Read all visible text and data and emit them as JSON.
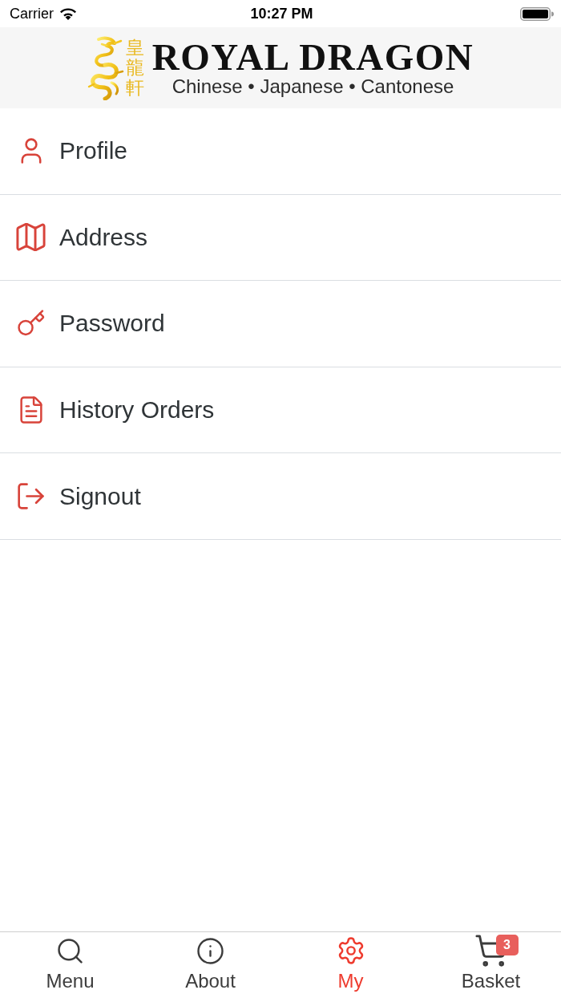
{
  "status_bar": {
    "carrier": "Carrier",
    "time": "10:27 PM"
  },
  "header": {
    "logo_characters": "皇龍軒",
    "title": "ROYAL DRAGON",
    "subtitle": "Chinese • Japanese • Cantonese"
  },
  "menu_items": [
    {
      "kind": "profile",
      "label": "Profile"
    },
    {
      "kind": "address",
      "label": "Address"
    },
    {
      "kind": "password",
      "label": "Password"
    },
    {
      "kind": "history",
      "label": "History Orders"
    },
    {
      "kind": "signout",
      "label": "Signout"
    }
  ],
  "tab_bar": [
    {
      "kind": "menu",
      "label": "Menu",
      "selected": false
    },
    {
      "kind": "about",
      "label": "About",
      "selected": false
    },
    {
      "kind": "my",
      "label": "My",
      "selected": true
    },
    {
      "kind": "basket",
      "label": "Basket",
      "selected": false,
      "badge": "3"
    }
  ]
}
